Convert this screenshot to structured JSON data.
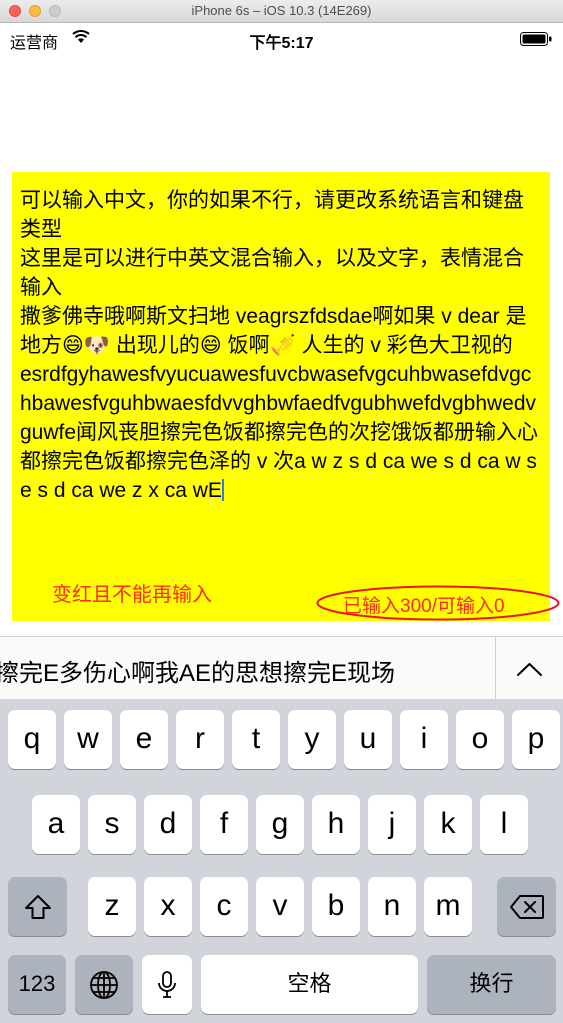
{
  "window": {
    "title": "iPhone 6s – iOS 10.3 (14E269)"
  },
  "status_bar": {
    "carrier": "运营商",
    "time": "下午5:17"
  },
  "editor": {
    "text": "可以输入中文，你的如果不行，请更改系统语言和键盘类型\n这里是可以进行中英文混合输入，以及文字，表情混合输入\n撒爹佛寺哦啊斯文扫地 veagrszfdsdae啊如果 v dear 是地方😄🐶 出现儿的😄 饭啊🎺 人生的 v 彩色大卫视的\nesrdfgyhawesfvyucuawesfuvcbwasefvgcuhbwasefdvgchbawesfvguhbwaesfdvvghbwfaedfvgubhwefdvgbhwedvguwfe闻风丧胆擦完色饭都擦完色的次挖饿饭都册输入心都擦完色饭都擦完色泽的 v 次a w z s d ca we s d ca w se s d ca we z x ca wE",
    "limit_note": "变红且不能再输入",
    "counter": "已输入300/可输入0",
    "counter_color": "#ff2a1a",
    "background_color": "#ffff00"
  },
  "candidate_bar": {
    "text": "擦完E多伤心啊我AE的思想擦完E现场",
    "expand_icon": "chevron-up-icon"
  },
  "keyboard": {
    "row1": [
      "q",
      "w",
      "e",
      "r",
      "t",
      "y",
      "u",
      "i",
      "o",
      "p"
    ],
    "row2": [
      "a",
      "s",
      "d",
      "f",
      "g",
      "h",
      "j",
      "k",
      "l"
    ],
    "row3": [
      "z",
      "x",
      "c",
      "v",
      "b",
      "n",
      "m"
    ],
    "shift_icon": "shift-icon",
    "delete_icon": "delete-icon",
    "numbers_label": "123",
    "globe_icon": "globe-icon",
    "mic_icon": "microphone-icon",
    "space_label": "空格",
    "return_label": "换行"
  }
}
